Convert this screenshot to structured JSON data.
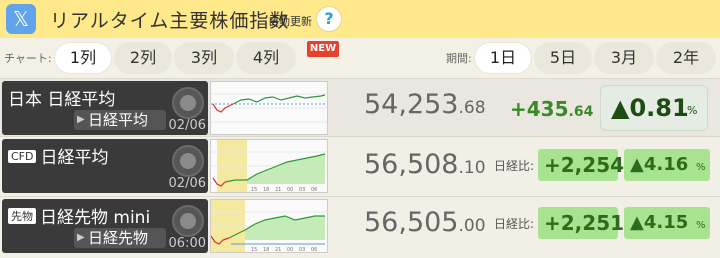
{
  "header": {
    "logo": "𝕏",
    "title": "リアルタイム主要株価指数",
    "subtitle": "自動更新",
    "help": "?"
  },
  "toolbar": {
    "columns_label": "チャート:",
    "columns": [
      "1列",
      "2列",
      "3列",
      "4列"
    ],
    "new_badge": "NEW",
    "period_label": "期間:",
    "periods": [
      "1日",
      "5日",
      "3月",
      "2年"
    ]
  },
  "rows": [
    {
      "name": "日本 日経平均",
      "sub": "日経平均",
      "time": "02/06",
      "price_int": "54,253",
      "price_dec": ".68",
      "change_int": "+435",
      "change_dec": ".64",
      "pct": "▲0.81",
      "pct_unit": "%"
    },
    {
      "tag": "CFD",
      "name": "日経平均",
      "time": "02/06",
      "price_int": "56,508",
      "price_dec": ".10",
      "nk_label": "日経比:",
      "diff": "+2,254",
      "pct": "▲4.16",
      "pct_unit": "%"
    },
    {
      "tag": "先物",
      "name": "日経先物 mini",
      "sub": "日経先物",
      "time": "06:00",
      "price_int": "56,505",
      "price_dec": ".00",
      "nk_label": "日経比:",
      "diff": "+2,251",
      "pct": "▲4.15",
      "pct_unit": "%"
    }
  ],
  "colors": {
    "header_bg": "#ffe98a",
    "up_green": "#3a8a2a",
    "green_box": "#a8e490",
    "x_blue": "#3f8fe0",
    "new_red": "#e6412e"
  }
}
